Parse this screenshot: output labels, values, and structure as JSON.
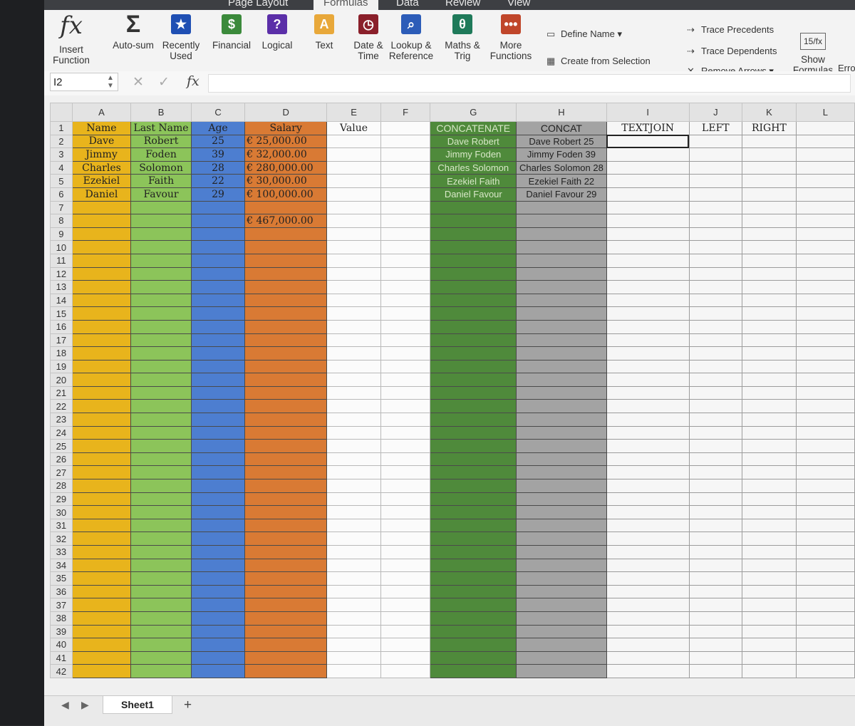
{
  "ribbon_tabs": [
    "Page Layout",
    "Formulas",
    "Data",
    "Review",
    "View"
  ],
  "ribbon": {
    "insert_function": "Insert Function",
    "groups": [
      {
        "label": "Auto-sum",
        "icon": "sigma-icon",
        "glyph": "Σ",
        "color": "#f3f3f3"
      },
      {
        "label": "Recently Used",
        "icon": "star-icon",
        "glyph": "★",
        "color": "#1f4fb3"
      },
      {
        "label": "Financial",
        "icon": "money-icon",
        "glyph": "$",
        "color": "#3b8a3b"
      },
      {
        "label": "Logical",
        "icon": "question-icon",
        "glyph": "?",
        "color": "#5b2fa8"
      },
      {
        "label": "Text",
        "icon": "text-icon",
        "glyph": "A",
        "color": "#e8a83a"
      },
      {
        "label": "Date & Time",
        "icon": "clock-icon",
        "glyph": "◷",
        "color": "#8a1f2a"
      },
      {
        "label": "Lookup & Reference",
        "icon": "magnifier-icon",
        "glyph": "⌕",
        "color": "#2c5cb8"
      },
      {
        "label": "Maths & Trig",
        "icon": "theta-icon",
        "glyph": "θ",
        "color": "#1f7a5a"
      },
      {
        "label": "More Functions",
        "icon": "more-icon",
        "glyph": "•••",
        "color": "#c0462a"
      }
    ],
    "define_name": "Define Name",
    "create_from_selection": "Create from Selection",
    "trace_precedents": "Trace Precedents",
    "trace_dependents": "Trace Dependents",
    "remove_arrows": "Remove Arrows",
    "show_formulas": "Show Formulas",
    "error_checking": "Erro"
  },
  "formula_bar": {
    "name_box": "I2",
    "fx": "fx"
  },
  "columns": [
    "A",
    "B",
    "C",
    "D",
    "E",
    "F",
    "G",
    "H",
    "I",
    "J",
    "K",
    "L"
  ],
  "row_count": 42,
  "header_row": [
    "Name",
    "Last Name",
    "Age",
    "Salary",
    "Value",
    "",
    "CONCATENATE",
    "CONCAT",
    "TEXTJOIN",
    "LEFT",
    "RIGHT",
    ""
  ],
  "data_rows": [
    [
      "Dave",
      "Robert",
      "25",
      "€  25,000.00",
      "",
      "",
      "Dave Robert",
      "Dave Robert 25",
      "",
      "",
      "",
      ""
    ],
    [
      "Jimmy",
      "Foden",
      "39",
      "€  32,000.00",
      "",
      "",
      "Jimmy Foden",
      "Jimmy Foden 39",
      "",
      "",
      "",
      ""
    ],
    [
      "Charles",
      "Solomon",
      "28",
      "€ 280,000.00",
      "",
      "",
      "Charles Solomon",
      "Charles Solomon 28",
      "",
      "",
      "",
      ""
    ],
    [
      "Ezekiel",
      "Faith",
      "22",
      "€  30,000.00",
      "",
      "",
      "Ezekiel Faith",
      "Ezekiel Faith 22",
      "",
      "",
      "",
      ""
    ],
    [
      "Daniel",
      "Favour",
      "29",
      "€ 100,000.00",
      "",
      "",
      "Daniel Favour",
      "Daniel Favour 29",
      "",
      "",
      "",
      ""
    ]
  ],
  "total": {
    "row": 8,
    "col": "D",
    "value": "€ 467,000.00"
  },
  "sheet_tab": "Sheet1",
  "add_sheet": "+"
}
